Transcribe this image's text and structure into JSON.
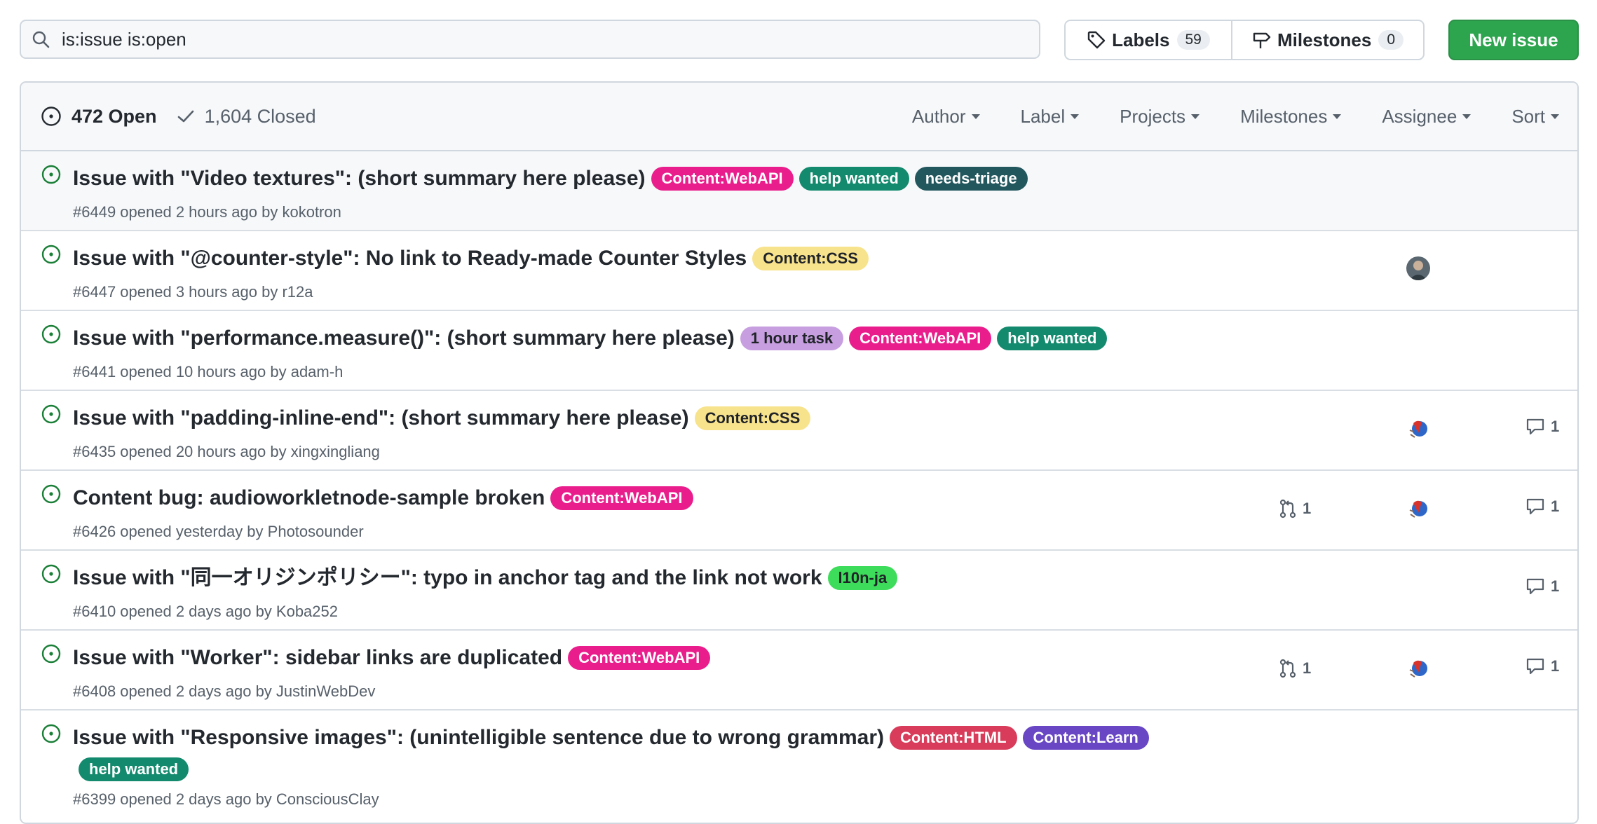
{
  "search": {
    "value": "is:issue is:open"
  },
  "toolbar": {
    "labels_label": "Labels",
    "labels_count": "59",
    "milestones_label": "Milestones",
    "milestones_count": "0",
    "new_issue_label": "New issue"
  },
  "header": {
    "open_label": "472 Open",
    "closed_label": "1,604 Closed",
    "filters": [
      "Author",
      "Label",
      "Projects",
      "Milestones",
      "Assignee",
      "Sort"
    ]
  },
  "issues": [
    {
      "title": "Issue with \"Video textures\": (short summary here please)",
      "meta": "#6449 opened 2 hours ago by kokotron",
      "labels": [
        "Content:WebAPI",
        "help wanted",
        "needs-triage"
      ]
    },
    {
      "title": "Issue with \"@counter-style\": No link to Ready-made Counter Styles",
      "meta": "#6447 opened 3 hours ago by r12a",
      "labels": [
        "Content:CSS"
      ]
    },
    {
      "title": "Issue with \"performance.measure()\": (short summary here please)",
      "meta": "#6441 opened 10 hours ago by adam-h",
      "labels": [
        "1 hour task",
        "Content:WebAPI",
        "help wanted"
      ]
    },
    {
      "title": "Issue with \"padding-inline-end\": (short summary here please)",
      "meta": "#6435 opened 20 hours ago by xingxingliang",
      "labels": [
        "Content:CSS"
      ],
      "comments": "1"
    },
    {
      "title": "Content bug: audioworkletnode-sample broken",
      "meta": "#6426 opened yesterday by Photosounder",
      "labels": [
        "Content:WebAPI"
      ],
      "prs": "1",
      "comments": "1"
    },
    {
      "title": "Issue with \"同一オリジンポリシー\": typo in anchor tag and the link not work",
      "meta": "#6410 opened 2 days ago by Koba252",
      "labels": [
        "l10n-ja"
      ],
      "comments": "1"
    },
    {
      "title": "Issue with \"Worker\": sidebar links are duplicated",
      "meta": "#6408 opened 2 days ago by JustinWebDev",
      "labels": [
        "Content:WebAPI"
      ],
      "prs": "1",
      "comments": "1"
    },
    {
      "title": "Issue with \"Responsive images\": (unintelligible sentence due to wrong grammar)",
      "meta": "#6399 opened 2 days ago by ConsciousClay",
      "labels": [
        "Content:HTML",
        "Content:Learn",
        "help wanted"
      ]
    }
  ],
  "label_colors": {
    "Content:WebAPI": "#e91e8c",
    "help wanted": "#138a6d",
    "needs-triage": "#23575e",
    "Content:CSS": "#f8e38d",
    "1 hour task": "#c79fe0",
    "l10n-ja": "#3ddc5a",
    "Content:HTML": "#d83c5a",
    "Content:Learn": "#6846c4"
  },
  "icons": {
    "search": "search-icon",
    "tag": "tag-icon",
    "milestone": "milestone-icon",
    "open": "issue-opened-icon",
    "closed": "check-icon",
    "pr": "git-pull-request-icon",
    "comment": "comment-icon"
  },
  "colors": {
    "accent_green": "#2da44e",
    "open_icon": "#1a7f37",
    "muted": "#57606a",
    "border": "#d0d7de"
  }
}
